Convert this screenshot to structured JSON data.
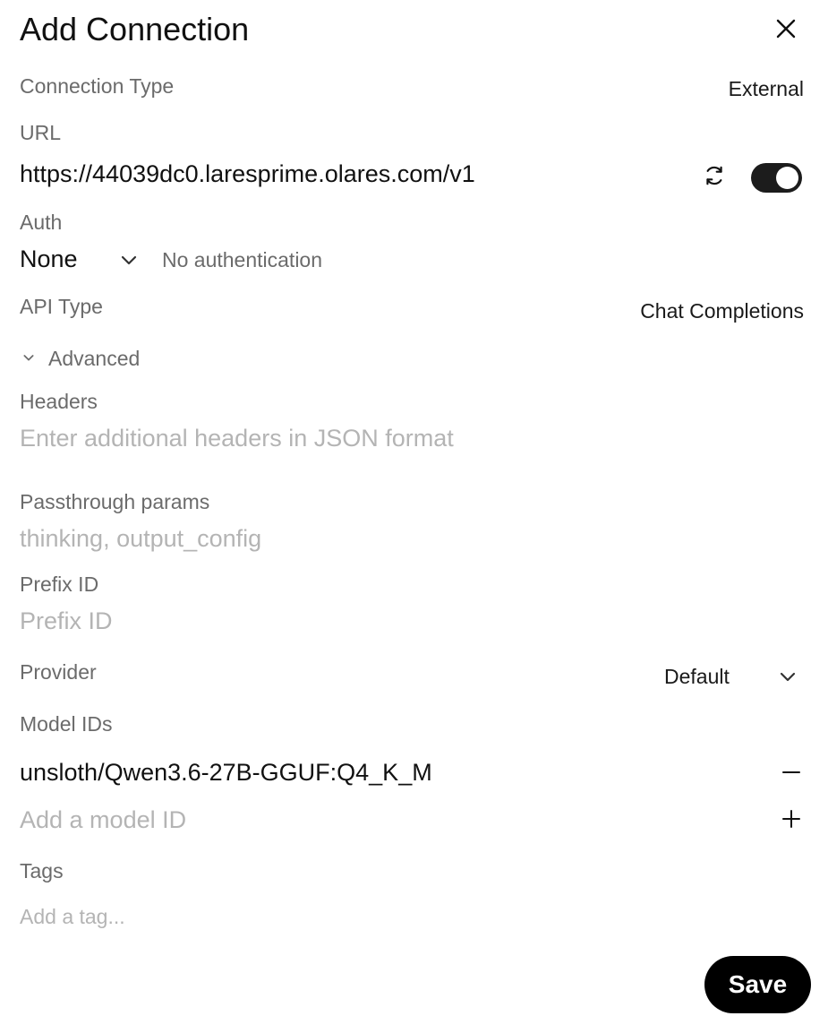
{
  "dialog": {
    "title": "Add Connection"
  },
  "connection_type": {
    "label": "Connection Type",
    "value": "External"
  },
  "url": {
    "label": "URL",
    "value": "https://44039dc0.laresprime.olares.com/v1",
    "enabled": true
  },
  "auth": {
    "label": "Auth",
    "value": "None",
    "description": "No authentication"
  },
  "api_type": {
    "label": "API Type",
    "value": "Chat Completions"
  },
  "advanced": {
    "label": "Advanced"
  },
  "headers": {
    "label": "Headers",
    "placeholder": "Enter additional headers in JSON format"
  },
  "passthrough": {
    "label": "Passthrough params",
    "placeholder": "thinking, output_config"
  },
  "prefix": {
    "label": "Prefix ID",
    "placeholder": "Prefix ID"
  },
  "provider": {
    "label": "Provider",
    "value": "Default"
  },
  "model_ids": {
    "label": "Model IDs",
    "items": [
      "unsloth/Qwen3.6-27B-GGUF:Q4_K_M"
    ],
    "add_placeholder": "Add a model ID"
  },
  "tags": {
    "label": "Tags",
    "placeholder": "Add a tag..."
  },
  "actions": {
    "save_label": "Save"
  },
  "icons": {
    "close": "close-icon",
    "refresh": "refresh-icon",
    "chevron": "chevron-down-icon",
    "remove": "minus-icon",
    "add": "plus-icon"
  },
  "colors": {
    "accent": "#000000",
    "toggle_on": "#1c1c1c",
    "label": "#6b6b6b",
    "placeholder": "#b4b4b4"
  }
}
